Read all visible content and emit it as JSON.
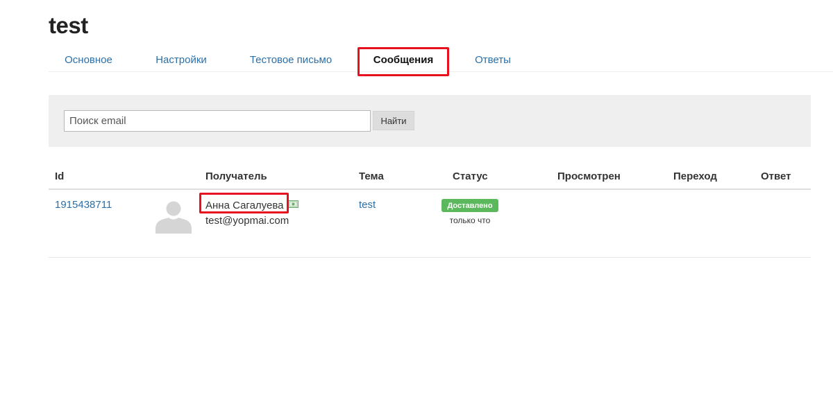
{
  "page": {
    "title": "test"
  },
  "tabs": [
    {
      "label": "Основное",
      "active": false
    },
    {
      "label": "Настройки",
      "active": false
    },
    {
      "label": "Тестовое письмо",
      "active": false
    },
    {
      "label": "Сообщения",
      "active": true
    },
    {
      "label": "Ответы",
      "active": false
    }
  ],
  "search": {
    "placeholder": "Поиск email",
    "value": "",
    "button_label": "Найти"
  },
  "table": {
    "columns": [
      "Id",
      "Получатель",
      "Тема",
      "Статус",
      "Просмотрен",
      "Переход",
      "Ответ"
    ],
    "rows": [
      {
        "id": "1915438711",
        "avatar_icon": "user-silhouette-icon",
        "recipient_name": "Анна Сагалуева",
        "recipient_badge_icon": "money-icon",
        "recipient_email": "test@yopmai.com",
        "subject": "test",
        "status": "Доставлено",
        "status_time": "только что",
        "viewed": "",
        "click": "",
        "reply": ""
      }
    ]
  },
  "colors": {
    "link": "#2a6fa8",
    "highlight": "#e8101e",
    "status_delivered": "#5cb85c",
    "panel_bg": "#efefef"
  }
}
